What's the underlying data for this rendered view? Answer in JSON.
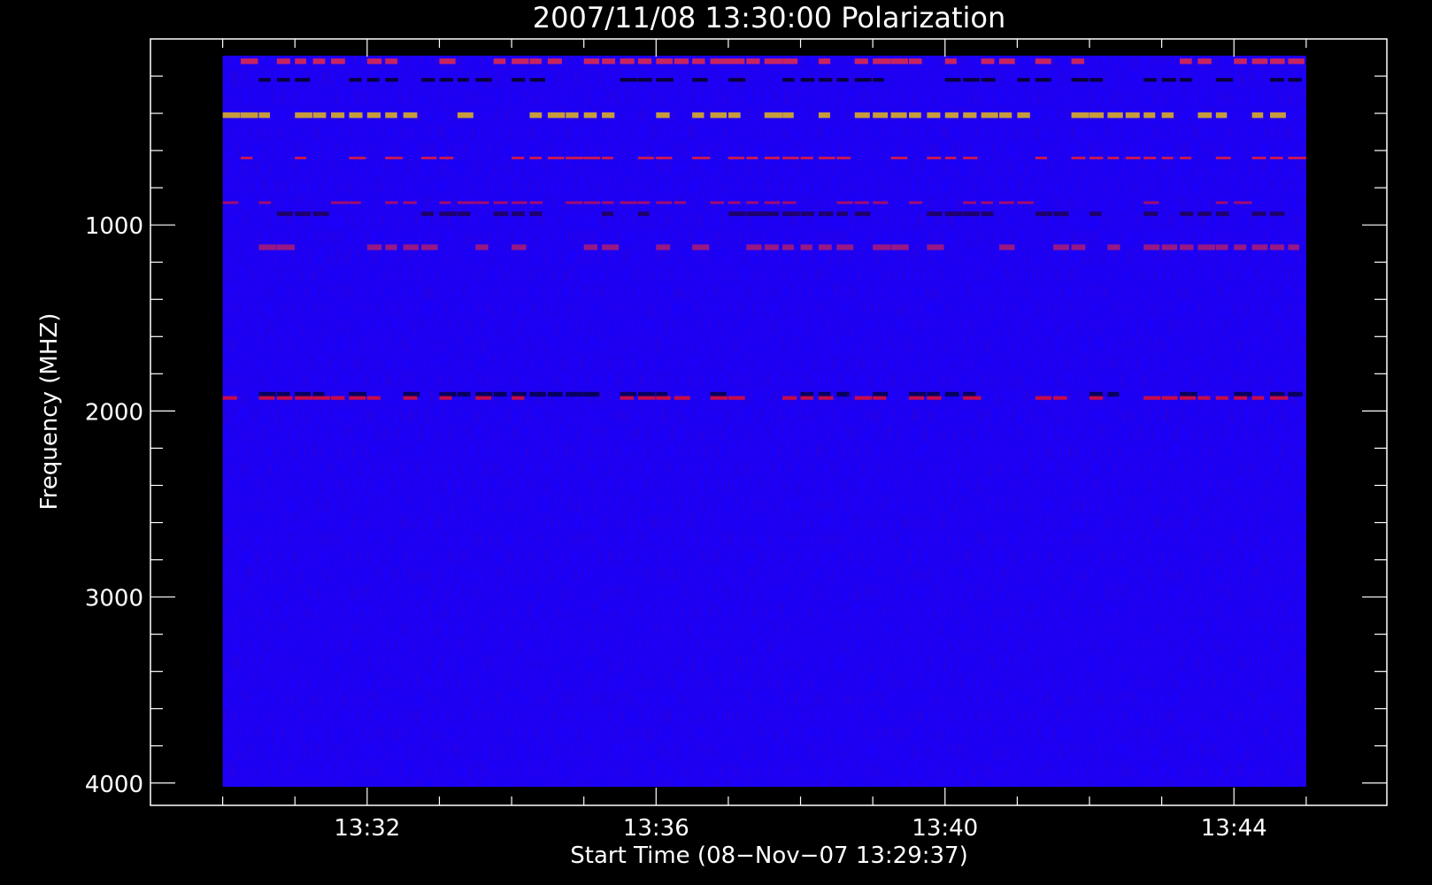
{
  "chart_data": {
    "type": "heatmap",
    "title": "2007/11/08 13:30:00 Polarization",
    "xlabel": "Start Time (08−Nov−07 13:29:37)",
    "ylabel": "Frequency (MHZ)",
    "x_ticks": [
      "13:32",
      "13:36",
      "13:40",
      "13:44"
    ],
    "x_tick_values_min": [
      2.383,
      6.383,
      10.383,
      14.383
    ],
    "xlim_min": [
      -0.617,
      16.5
    ],
    "data_x_range_min": [
      0.383,
      15.383
    ],
    "y_ticks": [
      "1000",
      "2000",
      "3000",
      "4000"
    ],
    "y_tick_values": [
      1000,
      2000,
      3000,
      4000
    ],
    "ylim": [
      0,
      4120
    ],
    "data_y_range": [
      90,
      4020
    ],
    "y_inverted": true,
    "colormap": [
      "#000000",
      "#0000ff",
      "#ff0000",
      "#ffff00"
    ],
    "background_value_color": "#1a00ff",
    "bands": [
      {
        "freq": 120,
        "width": 30,
        "intensity": "high",
        "color": "#ff3030"
      },
      {
        "freq": 220,
        "width": 20,
        "intensity": "dark",
        "color": "#000000"
      },
      {
        "freq": 410,
        "width": 30,
        "intensity": "very_high",
        "color": "#ffd000"
      },
      {
        "freq": 640,
        "width": 12,
        "intensity": "high",
        "color": "#ff2020"
      },
      {
        "freq": 880,
        "width": 12,
        "intensity": "medium",
        "color": "#d01040"
      },
      {
        "freq": 940,
        "width": 24,
        "intensity": "mixed",
        "color": "#200040"
      },
      {
        "freq": 1120,
        "width": 30,
        "intensity": "mixed",
        "color": "#c02060"
      },
      {
        "freq": 1910,
        "width": 25,
        "intensity": "mixed",
        "color": "#000030"
      },
      {
        "freq": 1930,
        "width": 20,
        "intensity": "spots",
        "color": "#ff1010"
      }
    ]
  }
}
